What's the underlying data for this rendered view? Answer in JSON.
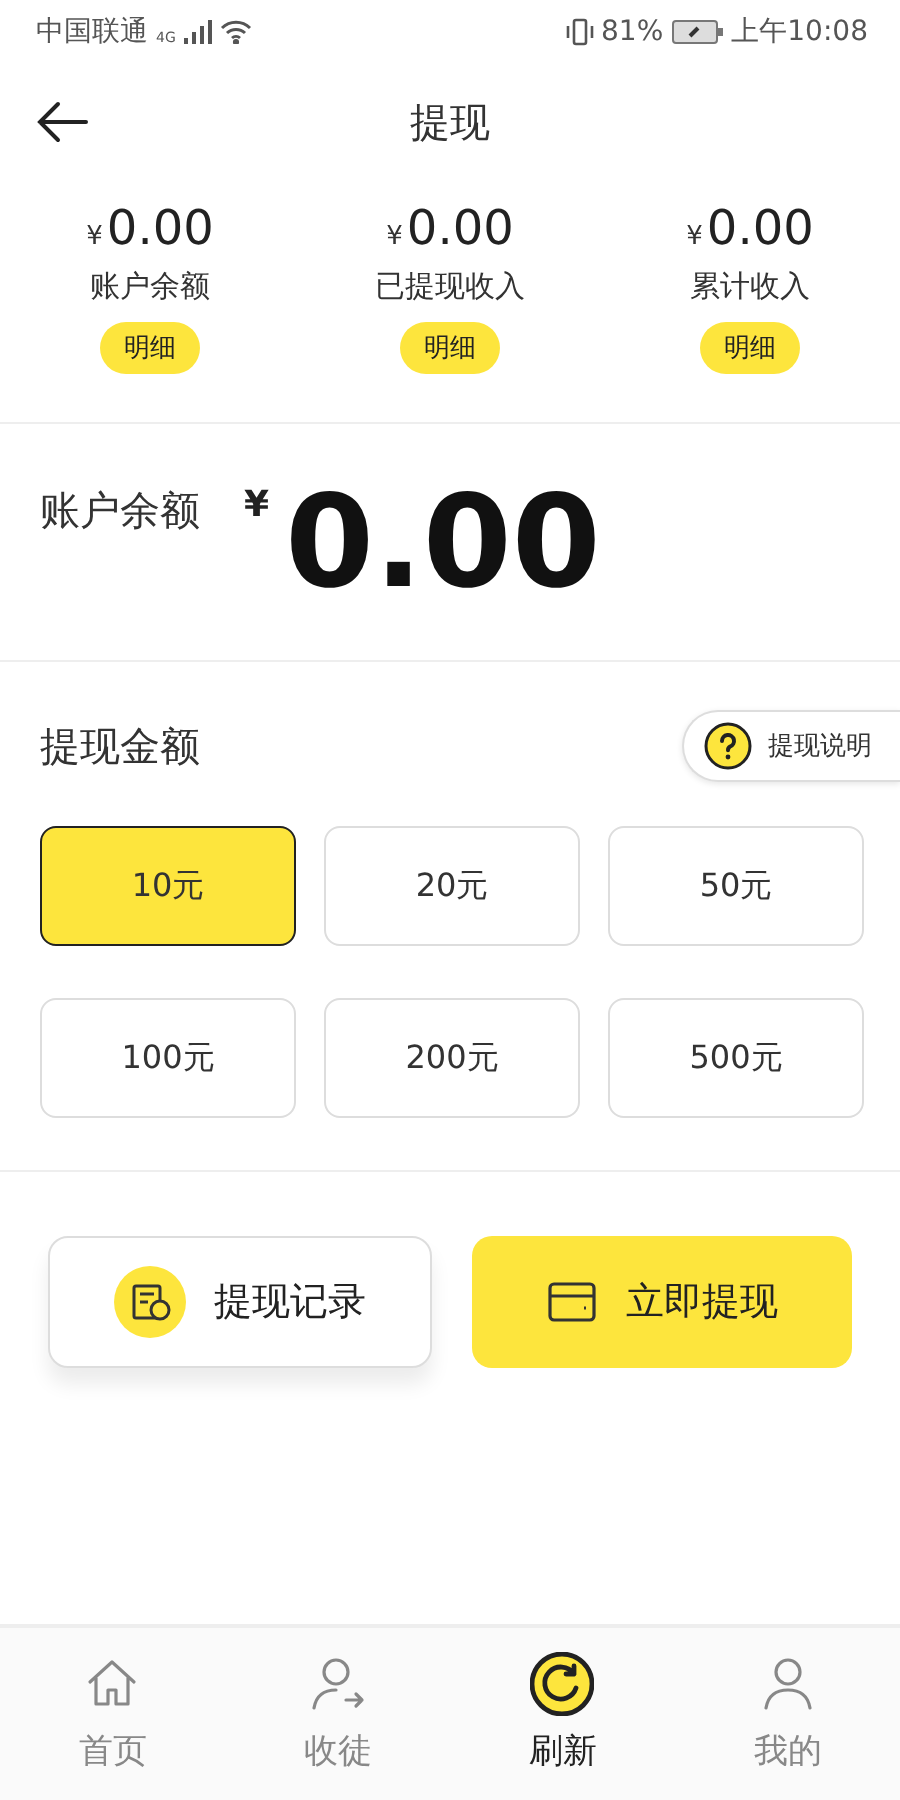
{
  "status_bar": {
    "carrier": "中国联通",
    "network": "4G",
    "battery": "81%",
    "time": "上午10:08"
  },
  "header": {
    "title": "提现"
  },
  "stats": [
    {
      "currency": "¥",
      "amount": "0.00",
      "label": "账户余额",
      "detail": "明细"
    },
    {
      "currency": "¥",
      "amount": "0.00",
      "label": "已提现收入",
      "detail": "明细"
    },
    {
      "currency": "¥",
      "amount": "0.00",
      "label": "累计收入",
      "detail": "明细"
    }
  ],
  "balance": {
    "label": "账户余额",
    "currency": "¥",
    "amount": "0.00"
  },
  "withdraw": {
    "title": "提现金额",
    "help": "提现说明",
    "options": [
      {
        "label": "10元",
        "selected": true
      },
      {
        "label": "20元",
        "selected": false
      },
      {
        "label": "50元",
        "selected": false
      },
      {
        "label": "100元",
        "selected": false
      },
      {
        "label": "200元",
        "selected": false
      },
      {
        "label": "500元",
        "selected": false
      }
    ]
  },
  "actions": [
    {
      "kind": "records",
      "label": "提现记录"
    },
    {
      "kind": "withdraw",
      "label": "立即提现"
    }
  ],
  "tab_bar": [
    {
      "kind": "home",
      "label": "首页",
      "selected": false
    },
    {
      "kind": "invite",
      "label": "收徒",
      "selected": false
    },
    {
      "kind": "refresh",
      "label": "刷新",
      "selected": true
    },
    {
      "kind": "profile",
      "label": "我的",
      "selected": false
    }
  ]
}
